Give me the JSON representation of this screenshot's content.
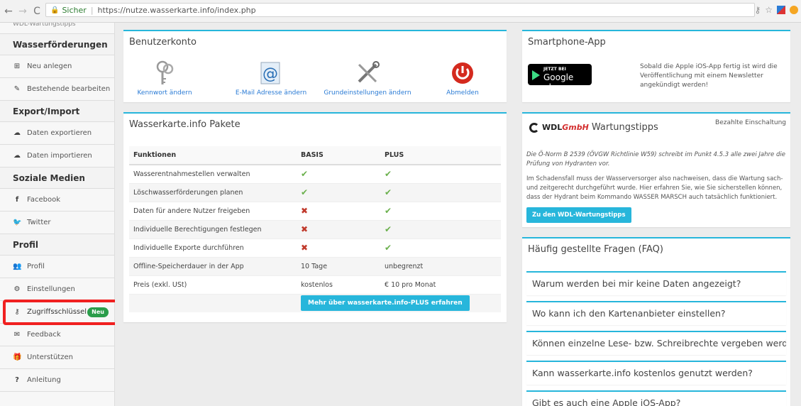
{
  "browser": {
    "secure_label": "Sicher",
    "url": "https://nutze.wasserkarte.info/index.php"
  },
  "sidebar": {
    "top_cut": "WDL-Wartungstipps",
    "sections": [
      {
        "header": "Wasserförderungen",
        "items": [
          {
            "label": "Neu anlegen",
            "icon": "plus-square-icon"
          },
          {
            "label": "Bestehende bearbeiten",
            "icon": "edit-icon"
          }
        ]
      },
      {
        "header": "Export/Import",
        "items": [
          {
            "label": "Daten exportieren",
            "icon": "cloud-icon"
          },
          {
            "label": "Daten importieren",
            "icon": "cloud-icon"
          }
        ]
      },
      {
        "header": "Soziale Medien",
        "items": [
          {
            "label": "Facebook",
            "icon": "facebook-icon"
          },
          {
            "label": "Twitter",
            "icon": "twitter-icon"
          }
        ]
      },
      {
        "header": "Profil",
        "items": [
          {
            "label": "Profil",
            "icon": "users-icon"
          },
          {
            "label": "Einstellungen",
            "icon": "gears-icon"
          },
          {
            "label": "Zugriffsschlüssel",
            "icon": "key-icon",
            "badge": "Neu"
          },
          {
            "label": "Feedback",
            "icon": "envelope-icon"
          },
          {
            "label": "Unterstützen",
            "icon": "gift-icon"
          },
          {
            "label": "Anleitung",
            "icon": "question-icon"
          }
        ]
      }
    ]
  },
  "account": {
    "title": "Benutzerkonto",
    "items": [
      {
        "label": "Kennwort ändern",
        "icon": "keys-icon"
      },
      {
        "label": "E-Mail Adresse ändern",
        "icon": "at-icon"
      },
      {
        "label": "Grundeinstellungen ändern",
        "icon": "tools-icon"
      },
      {
        "label": "Abmelden",
        "icon": "power-icon"
      }
    ]
  },
  "packages": {
    "title": "Wasserkarte.info Pakete",
    "columns": [
      "Funktionen",
      "BASIS",
      "PLUS"
    ],
    "rows": [
      {
        "feature": "Wasserentnahmestellen verwalten",
        "basis": "check",
        "plus": "check"
      },
      {
        "feature": "Löschwasserförderungen planen",
        "basis": "check",
        "plus": "check"
      },
      {
        "feature": "Daten für andere Nutzer freigeben",
        "basis": "cross",
        "plus": "check"
      },
      {
        "feature": "Individuelle Berechtigungen festlegen",
        "basis": "cross",
        "plus": "check"
      },
      {
        "feature": "Individuelle Exporte durchführen",
        "basis": "cross",
        "plus": "check"
      },
      {
        "feature": "Offline-Speicherdauer in der App",
        "basis": "10 Tage",
        "plus": "unbegrenzt"
      },
      {
        "feature": "Preis (exkl. USt)",
        "basis": "kostenlos",
        "plus": "€ 10 pro Monat"
      }
    ],
    "cta": "Mehr über wasserkarte.info-PLUS erfahren"
  },
  "app": {
    "title": "Smartphone-App",
    "badge_small": "JETZT BEI",
    "badge_big": "Google play",
    "text": "Sobald die Apple iOS-App fertig ist wird die Veröffentlichung mit einem Newsletter angekündigt werden!"
  },
  "wdl": {
    "paid_label": "Bezahlte Einschaltung",
    "logo_a": "WDL",
    "logo_b": "GmbH",
    "title": "Wartungstipps",
    "text1": "Die Ö-Norm B 2539 (ÖVGW Richtlinie W59) schreibt im Punkt 4.5.3 alle zwei Jahre die Prüfung von Hydranten vor.",
    "text2": "Im Schadensfall muss der Wasserversorger also nachweisen, dass die Wartung sach- und zeitgerecht durchgeführt wurde. Hier erfahren Sie, wie Sie sicherstellen können, dass der Hydrant beim Kommando WASSER MARSCH auch tatsächlich funktioniert.",
    "button": "Zu den WDL-Wartungstipps"
  },
  "faq": {
    "title": "Häufig gestellte Fragen (FAQ)",
    "items": [
      "Warum werden bei mir keine Daten angezeigt?",
      "Wo kann ich den Kartenanbieter einstellen?",
      "Können einzelne Lese- bzw. Schreibrechte vergeben werden.",
      "Kann wasserkarte.info kostenlos genutzt werden?",
      "Gibt es auch eine Apple iOS-App?"
    ]
  },
  "colors": {
    "accent": "#27b6db",
    "check": "#6ab04c",
    "cross": "#c0392b",
    "highlight": "#f02020"
  }
}
